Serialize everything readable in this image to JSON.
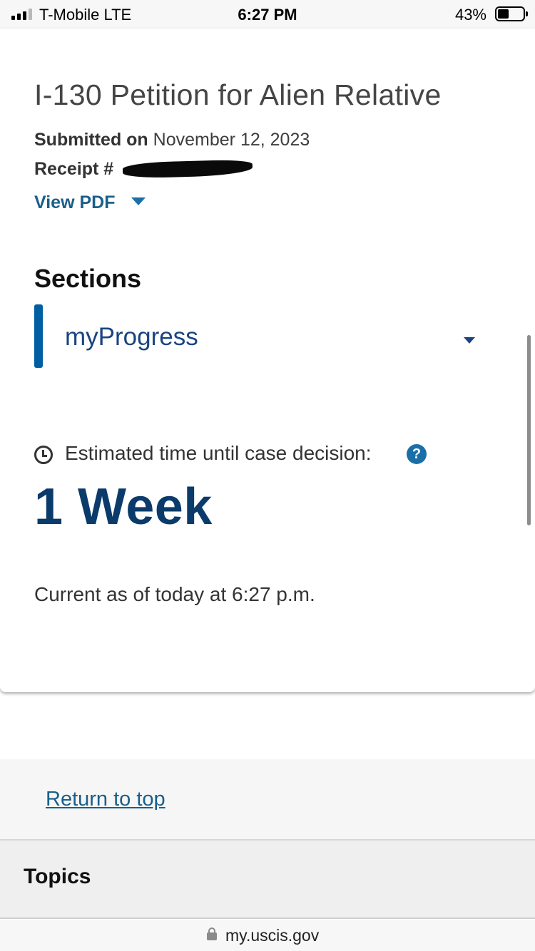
{
  "status_bar": {
    "carrier": "T-Mobile  LTE",
    "time": "6:27 PM",
    "battery": "43%",
    "battery_level": 0.43,
    "signal_bars_filled": 3,
    "signal_bars_total": 4
  },
  "case": {
    "title": "I-130 Petition for Alien Relative",
    "submitted_label": "Submitted on",
    "submitted_date": "November 12, 2023",
    "receipt_label": "Receipt #",
    "view_pdf": "View PDF"
  },
  "sections": {
    "heading": "Sections",
    "selected": "myProgress"
  },
  "estimate": {
    "label": "Estimated time until case decision:",
    "help_symbol": "?",
    "value": "1 Week",
    "current_as_of": "Current as of today at 6:27 p.m."
  },
  "footer": {
    "return_to_top": "Return to top",
    "topics": "Topics"
  },
  "browser": {
    "url": "my.uscis.gov"
  },
  "colors": {
    "link": "#1a5f8a",
    "accent": "#005ea2",
    "estimate": "#0b3b6b"
  },
  "icons": [
    "signal-icon",
    "battery-icon",
    "chevron-down-icon",
    "clock-icon",
    "help-icon",
    "lock-icon"
  ]
}
